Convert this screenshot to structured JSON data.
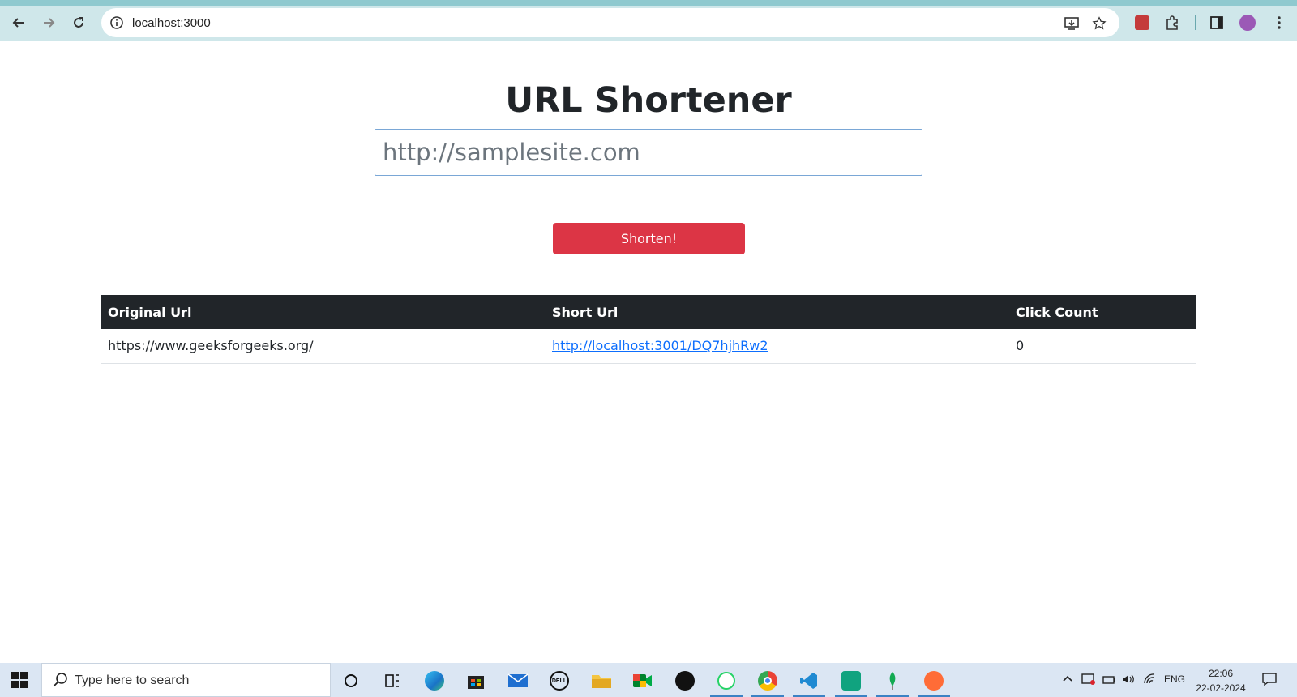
{
  "browser": {
    "url": "localhost:3000",
    "accent_color": "#cfe7ea"
  },
  "page": {
    "title": "URL Shortener",
    "input": {
      "placeholder": "http://samplesite.com",
      "value": ""
    },
    "button_label": "Shorten!",
    "table": {
      "headers": [
        "Original Url",
        "Short Url",
        "Click Count"
      ],
      "rows": [
        {
          "original": "https://www.geeksforgeeks.org/",
          "short": "http://localhost:3001/DQ7hjhRw2",
          "clicks": "0"
        }
      ]
    }
  },
  "taskbar": {
    "search_placeholder": "Type here to search",
    "tray_language": "ENG",
    "time": "22:06",
    "date": "22-02-2024"
  }
}
